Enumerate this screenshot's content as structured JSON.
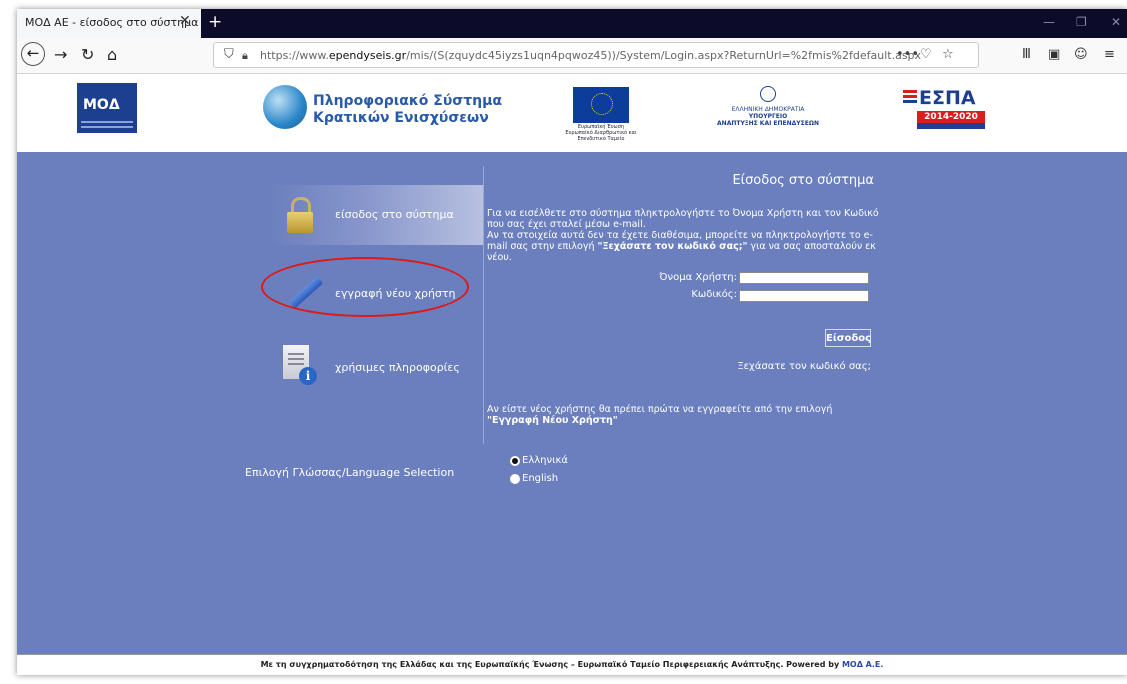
{
  "browser": {
    "tab_title": "ΜΟΔ ΑΕ - είσοδος στο σύστημα",
    "tab_close": "✕",
    "new_tab": "+",
    "url_prefix": "https://www.",
    "url_domain": "ependyseis.gr",
    "url_rest": "/mis/(S(zquydc45iyzs1uqn4pqwoz45))/System/Login.aspx?ReturnUrl=%2fmis%2fdefault.aspx",
    "icons": {
      "back": "back-arrow-icon",
      "forward": "forward-arrow-icon",
      "reload": "reload-icon",
      "home": "home-icon",
      "shield": "shield-icon",
      "lock": "padlock-icon",
      "more": "more-icon",
      "pocket": "pocket-icon",
      "bookmark": "star-icon",
      "library": "library-icon",
      "sidebar": "sidebar-icon",
      "account": "account-icon",
      "menu": "hamburger-menu-icon",
      "minimize": "minimize-icon",
      "maximize": "maximize-icon",
      "close": "close-icon"
    }
  },
  "header": {
    "moda_logo": "ΜΟΔ",
    "psk_line1": "Πληροφοριακό Σύστημα",
    "psk_line2": "Κρατικών Ενισχύσεων",
    "eu_caption": "Ευρωπαϊκή Ένωση Ευρωπαϊκό Διαρθρωτικό και Επενδυτικό Ταμείο",
    "gr_line1": "ΕΛΛΗΝΙΚΗ ΔΗΜΟΚΡΑΤΙΑ",
    "gr_line2": "ΥΠΟΥΡΓΕΙΟ",
    "gr_line3": "ΑΝΑΠΤΥΞΗΣ ΚΑΙ ΕΠΕΝΔΥΣΕΩΝ",
    "espa_title": "ΕΣΠΑ",
    "espa_years": "2014-2020"
  },
  "menu": {
    "login": "είσοδος στο σύστημα",
    "register": "εγγραφή νέου χρήστη",
    "info": "χρήσιμες πληροφορίες"
  },
  "login": {
    "title": "Είσοδος στο σύστημα",
    "intro1": "Για να εισέλθετε στο σύστημα πληκτρολογήστε το Όνομα Χρήστη και τον Κωδικό που σας έχει σταλεί μέσω e-mail.",
    "intro2": "Αν τα στοιχεία αυτά δεν τα έχετε διαθέσιμα, μπορείτε να πληκτρολογήστε το e-mail σας στην επιλογή ",
    "intro2_bold": "\"Ξεχάσατε τον κωδικό σας;\"",
    "intro2_end": " για να σας αποσταλούν εκ νέου.",
    "username_label": "Όνομα Χρήστη:",
    "password_label": "Κωδικός:",
    "submit": "Είσοδος",
    "forgot": "Ξεχάσατε τον κωδικό σας;",
    "new_user": "Αν είστε νέος χρήστης θα πρέπει πρώτα να εγγραφείτε από την επιλογή ",
    "new_user_bold": "\"Εγγραφή Νέου Χρήστη\""
  },
  "language": {
    "label": "Επιλογή Γλώσσας/Language Selection",
    "options": [
      "Ελληνικά",
      "English"
    ],
    "selected": "Ελληνικά"
  },
  "footer": {
    "text": "Με τη συγχρηματοδότηση της Ελλάδας και της Ευρωπαϊκής Ένωσης – Ευρωπαϊκό Ταμείο Περιφερειακής Ανάπτυξης.  Powered by ",
    "link": "ΜΟΔ Α.Ε."
  }
}
